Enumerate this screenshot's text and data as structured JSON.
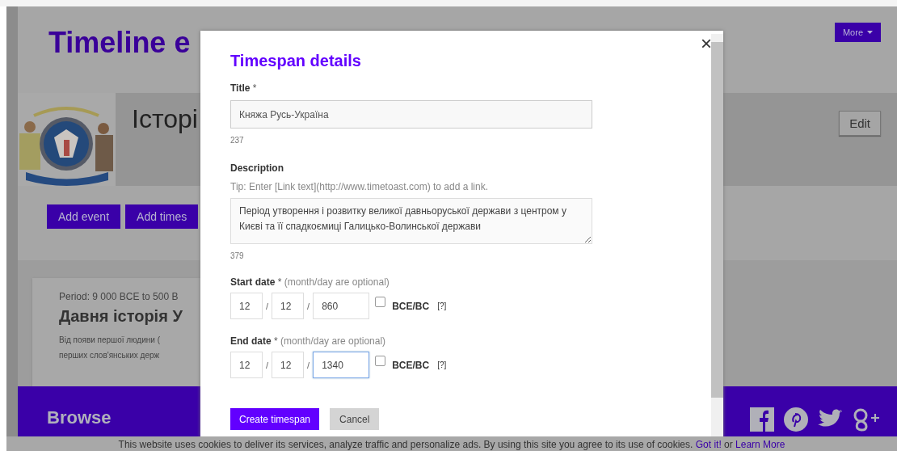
{
  "page": {
    "heading": "Timeline e",
    "more_button": "More",
    "timeline_title": "Історі",
    "edit_button": "Edit",
    "action_buttons": [
      "Add event",
      "Add times"
    ],
    "card": {
      "period": "Period: 9 000 BCE to 500 B",
      "title": "Давня історія У",
      "text_lines": [
        "Від появи першої людини (",
        "перших слов'янських держ"
      ]
    },
    "browse": "Browse"
  },
  "modal": {
    "title": "Timespan details",
    "close": "×",
    "title_field": {
      "label": "Title",
      "required": "*",
      "value": "Княжа Русь-Україна",
      "counter": "237"
    },
    "description": {
      "label": "Description",
      "tip": "Tip: Enter [Link text](http://www.timetoast.com) to add a link.",
      "value": "Період утворення і розвитку великої давньоруської держави з центром у Києві та її спадкоємиці Галицько-Волинської держави",
      "counter": "379"
    },
    "dates": [
      {
        "label": "Start date",
        "required": "*",
        "hint": "(month/day are optional)",
        "month": "12",
        "day": "12",
        "year": "860",
        "year_focused": false,
        "bce_checked": false,
        "bce_label": "BCE/BC",
        "help": "[?]",
        "sep": "/"
      },
      {
        "label": "End date",
        "required": "*",
        "hint": "(month/day are optional)",
        "month": "12",
        "day": "12",
        "year": "1340",
        "year_focused": true,
        "bce_checked": false,
        "bce_label": "BCE/BC",
        "help": "[?]",
        "sep": "/"
      }
    ],
    "submit": "Create timespan",
    "cancel": "Cancel"
  },
  "cookie_bar": {
    "text": "This website uses cookies to deliver its services, analyze traffic and personalize ads. By using this site you agree to its use of cookies.",
    "got_it": "Got it!",
    "or": "or",
    "learn_more": "Learn More"
  }
}
